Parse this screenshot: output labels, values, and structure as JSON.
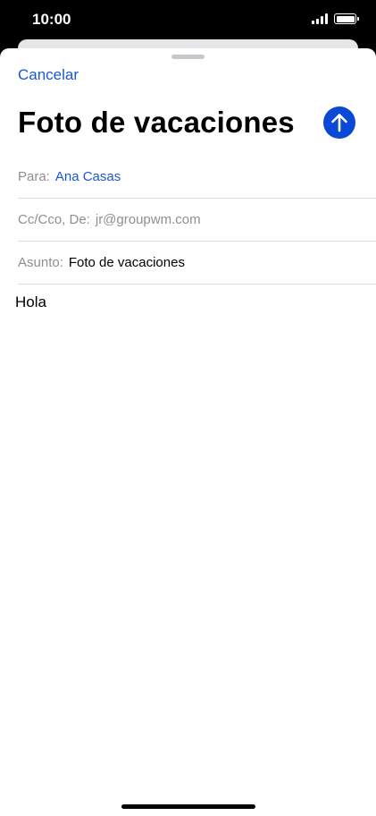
{
  "status_bar": {
    "time": "10:00"
  },
  "compose": {
    "cancel_label": "Cancelar",
    "title": "Foto de vacaciones",
    "send_icon": "arrow-up-icon",
    "to_label": "Para:",
    "to_value": "Ana Casas",
    "cc_label": "Cc/Cco, De:",
    "cc_value": "jr@groupwm.com",
    "subject_label": "Asunto:",
    "subject_value": "Foto de vacaciones",
    "body": "Hola"
  },
  "colors": {
    "accent": "#1a56d6",
    "send_button": "#0a49d6",
    "secondary_text": "#8e8e93",
    "separator": "#dcdcdf"
  }
}
